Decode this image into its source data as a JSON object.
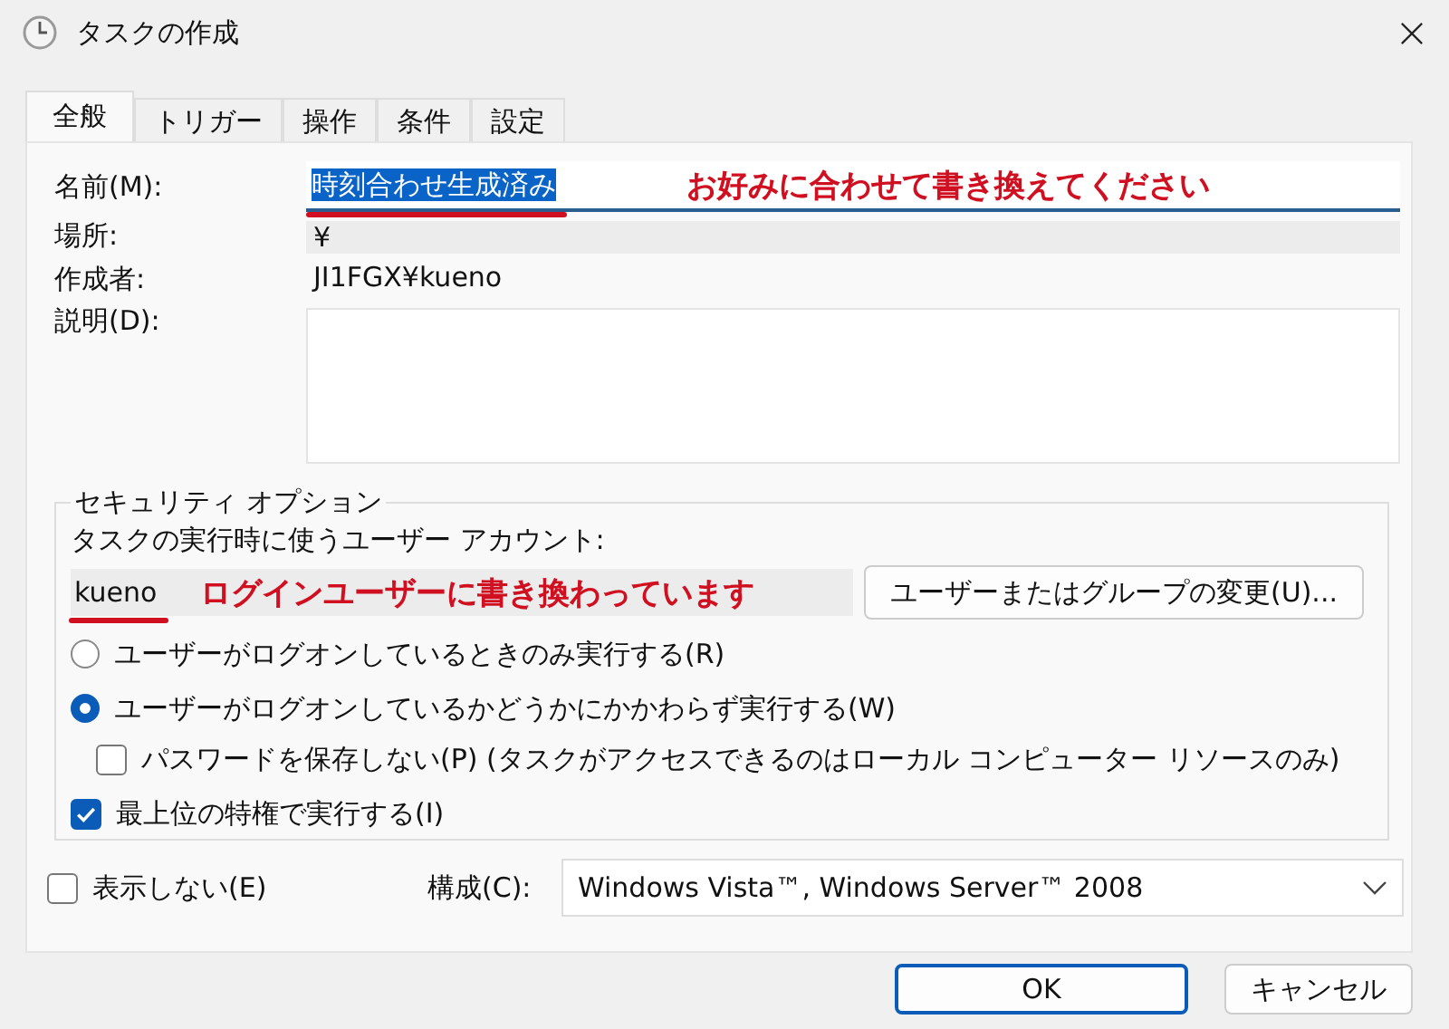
{
  "window": {
    "title": "タスクの作成"
  },
  "tabs": [
    {
      "label": "全般",
      "selected": true
    },
    {
      "label": "トリガー",
      "selected": false
    },
    {
      "label": "操作",
      "selected": false
    },
    {
      "label": "条件",
      "selected": false
    },
    {
      "label": "設定",
      "selected": false
    }
  ],
  "general": {
    "name_label": "名前(M):",
    "name_value": "時刻合わせ生成済み",
    "name_annotation": "お好みに合わせて書き換えてください",
    "location_label": "場所:",
    "location_value": "¥",
    "author_label": "作成者:",
    "author_value": "JI1FGX¥kueno",
    "description_label": "説明(D):"
  },
  "security": {
    "legend": "セキュリティ オプション",
    "account_label": "タスクの実行時に使うユーザー アカウント:",
    "account_value": "kueno",
    "account_annotation": "ログインユーザーに書き換わっています",
    "change_button": "ユーザーまたはグループの変更(U)...",
    "options": [
      {
        "kind": "radio",
        "label": "ユーザーがログオンしているときのみ実行する(R)",
        "selected": false
      },
      {
        "kind": "radio",
        "label": "ユーザーがログオンしているかどうかにかかわらず実行する(W)",
        "selected": true
      },
      {
        "kind": "subcheck",
        "label": "パスワードを保存しない(P) (タスクがアクセスできるのはローカル コンピューター リソースのみ)",
        "checked": false
      },
      {
        "kind": "check",
        "label": "最上位の特権で実行する(I)",
        "checked": true
      }
    ]
  },
  "hidden": {
    "label": "表示しない(E)",
    "checked": false
  },
  "configure": {
    "label": "構成(C):",
    "value": "Windows Vista™, Windows Server™ 2008"
  },
  "buttons": [
    "OK",
    "キャンセル"
  ]
}
